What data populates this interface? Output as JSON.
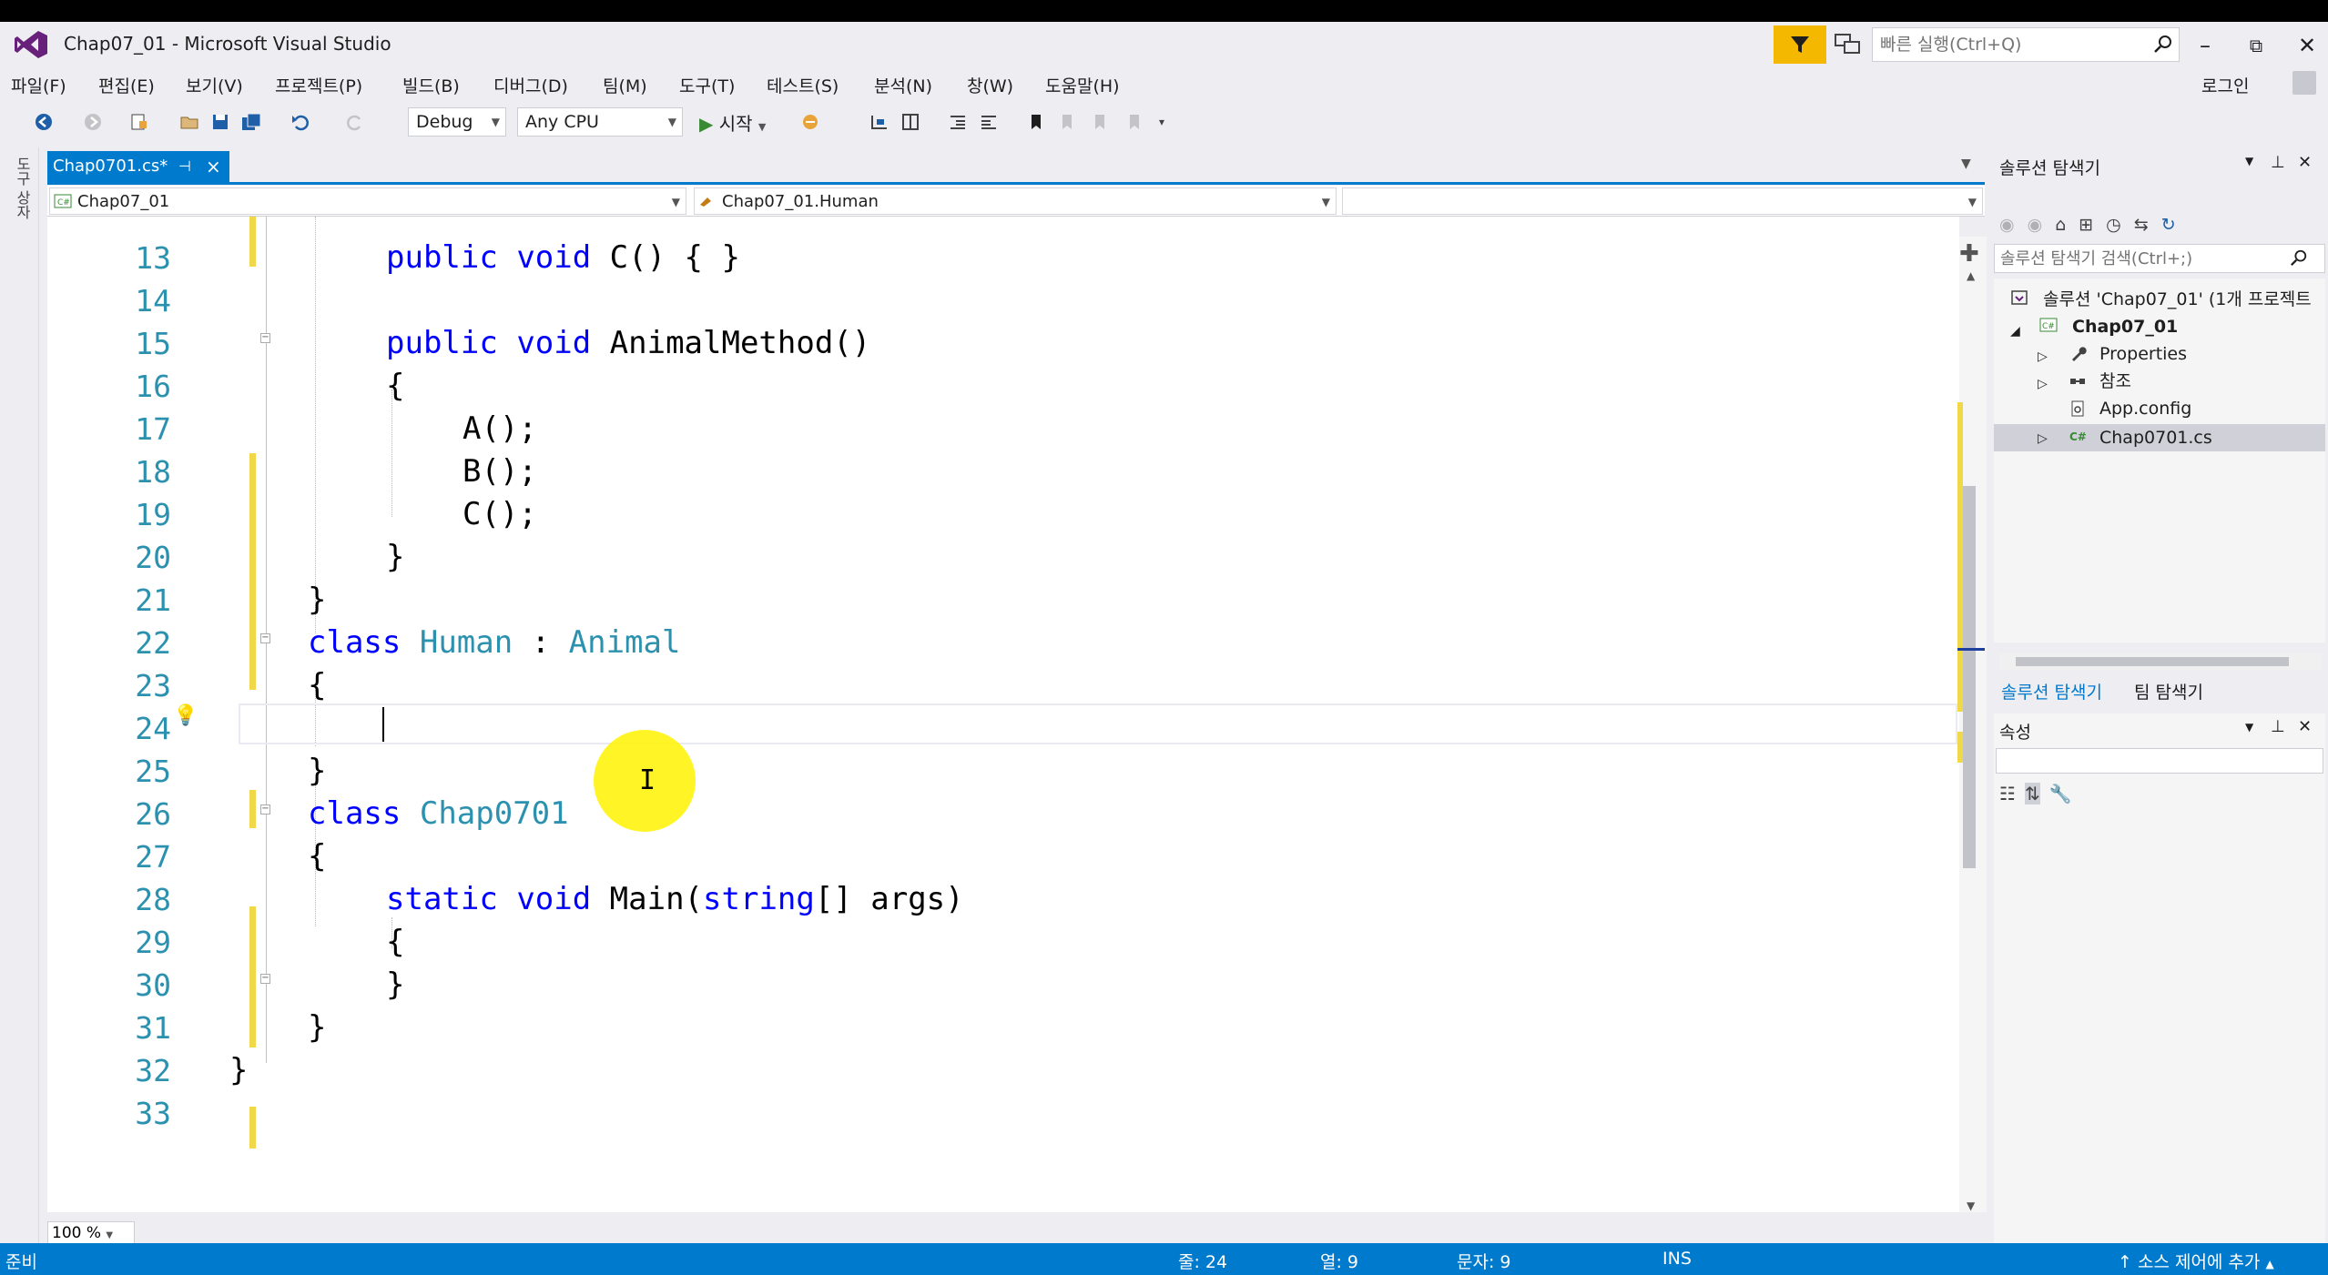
{
  "window": {
    "title": "Chap07_01 - Microsoft Visual Studio",
    "quick_launch_placeholder": "빠른 실행(Ctrl+Q)",
    "login": "로그인"
  },
  "menu": [
    "파일(F)",
    "편집(E)",
    "보기(V)",
    "프로젝트(P)",
    "빌드(B)",
    "디버그(D)",
    "팀(M)",
    "도구(T)",
    "테스트(S)",
    "분석(N)",
    "창(W)",
    "도움말(H)"
  ],
  "toolbar": {
    "config": "Debug",
    "platform": "Any CPU",
    "start_label": "시작"
  },
  "left_strip_label": "도구 상자",
  "doc_tab": {
    "label": "Chap0701.cs*"
  },
  "nav": {
    "project": "Chap07_01",
    "type": "Chap07_01.Human",
    "member": ""
  },
  "editor": {
    "lines": [
      {
        "n": "13"
      },
      {
        "n": "14"
      },
      {
        "n": "15"
      },
      {
        "n": "16"
      },
      {
        "n": "17"
      },
      {
        "n": "18"
      },
      {
        "n": "19"
      },
      {
        "n": "20"
      },
      {
        "n": "21"
      },
      {
        "n": "22"
      },
      {
        "n": "23"
      },
      {
        "n": "24"
      },
      {
        "n": "25"
      },
      {
        "n": "26"
      },
      {
        "n": "27"
      },
      {
        "n": "28"
      },
      {
        "n": "29"
      },
      {
        "n": "30"
      },
      {
        "n": "31"
      },
      {
        "n": "32"
      },
      {
        "n": "33"
      }
    ],
    "zoom": "100 %"
  },
  "solution_explorer": {
    "title": "솔루션 탐색기",
    "search_placeholder": "솔루션 탐색기 검색(Ctrl+;)",
    "solution": "솔루션 'Chap07_01' (1개 프로젝트",
    "project": "Chap07_01",
    "items": [
      "Properties",
      "참조",
      "App.config",
      "Chap0701.cs"
    ],
    "tabs": [
      "솔루션 탐색기",
      "팀 탐색기"
    ]
  },
  "properties": {
    "title": "속성"
  },
  "status": {
    "ready": "준비",
    "line": "줄: 24",
    "col": "열: 9",
    "ch": "문자: 9",
    "mode": "INS",
    "source_control": "소스 제어에 추가"
  },
  "colors": {
    "accent": "#007acc",
    "keyword": "#0000ff",
    "type": "#2b91af",
    "change_marker": "#efd84a",
    "filter": "#f5b800"
  }
}
